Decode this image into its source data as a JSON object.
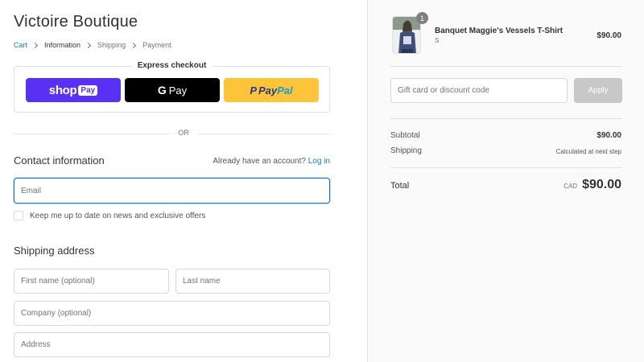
{
  "store": {
    "title": "Victoire Boutique"
  },
  "breadcrumb": {
    "items": [
      {
        "label": "Cart"
      },
      {
        "label": "Information"
      },
      {
        "label": "Shipping"
      },
      {
        "label": "Payment"
      }
    ]
  },
  "express": {
    "label": "Express checkout",
    "shop_word": "shop",
    "shop_pay": "Pay",
    "gpay_g": "G",
    "gpay_pay": "Pay",
    "paypal_mark": "P",
    "paypal_pay": "Pay",
    "paypal_pal": "Pal"
  },
  "divider": {
    "or": "OR"
  },
  "contact": {
    "heading": "Contact information",
    "account_prompt": "Already have an account?",
    "login": "Log in",
    "email_placeholder": "Email",
    "newsletter": "Keep me up to date on news and exclusive offers"
  },
  "shipping": {
    "heading": "Shipping address",
    "first_placeholder": "First name (optional)",
    "last_placeholder": "Last name",
    "company_placeholder": "Company (optional)",
    "address_placeholder": "Address"
  },
  "cart": {
    "quantity": "1",
    "product_name": "Banquet Maggie's Vessels T-Shirt",
    "variant": "S",
    "price": "$90.00",
    "discount_placeholder": "Gift card or discount code",
    "apply": "Apply",
    "subtotal_label": "Subtotal",
    "subtotal_value": "$90.00",
    "shipping_label": "Shipping",
    "shipping_value": "Calculated at next step",
    "total_label": "Total",
    "currency": "CAD",
    "total_value": "$90.00"
  },
  "colors": {
    "link": "#1979c3",
    "shop_pay": "#5a31f4",
    "google_pay": "#000000",
    "paypal": "#ffc439",
    "apply_disabled": "#c8c8c8"
  }
}
